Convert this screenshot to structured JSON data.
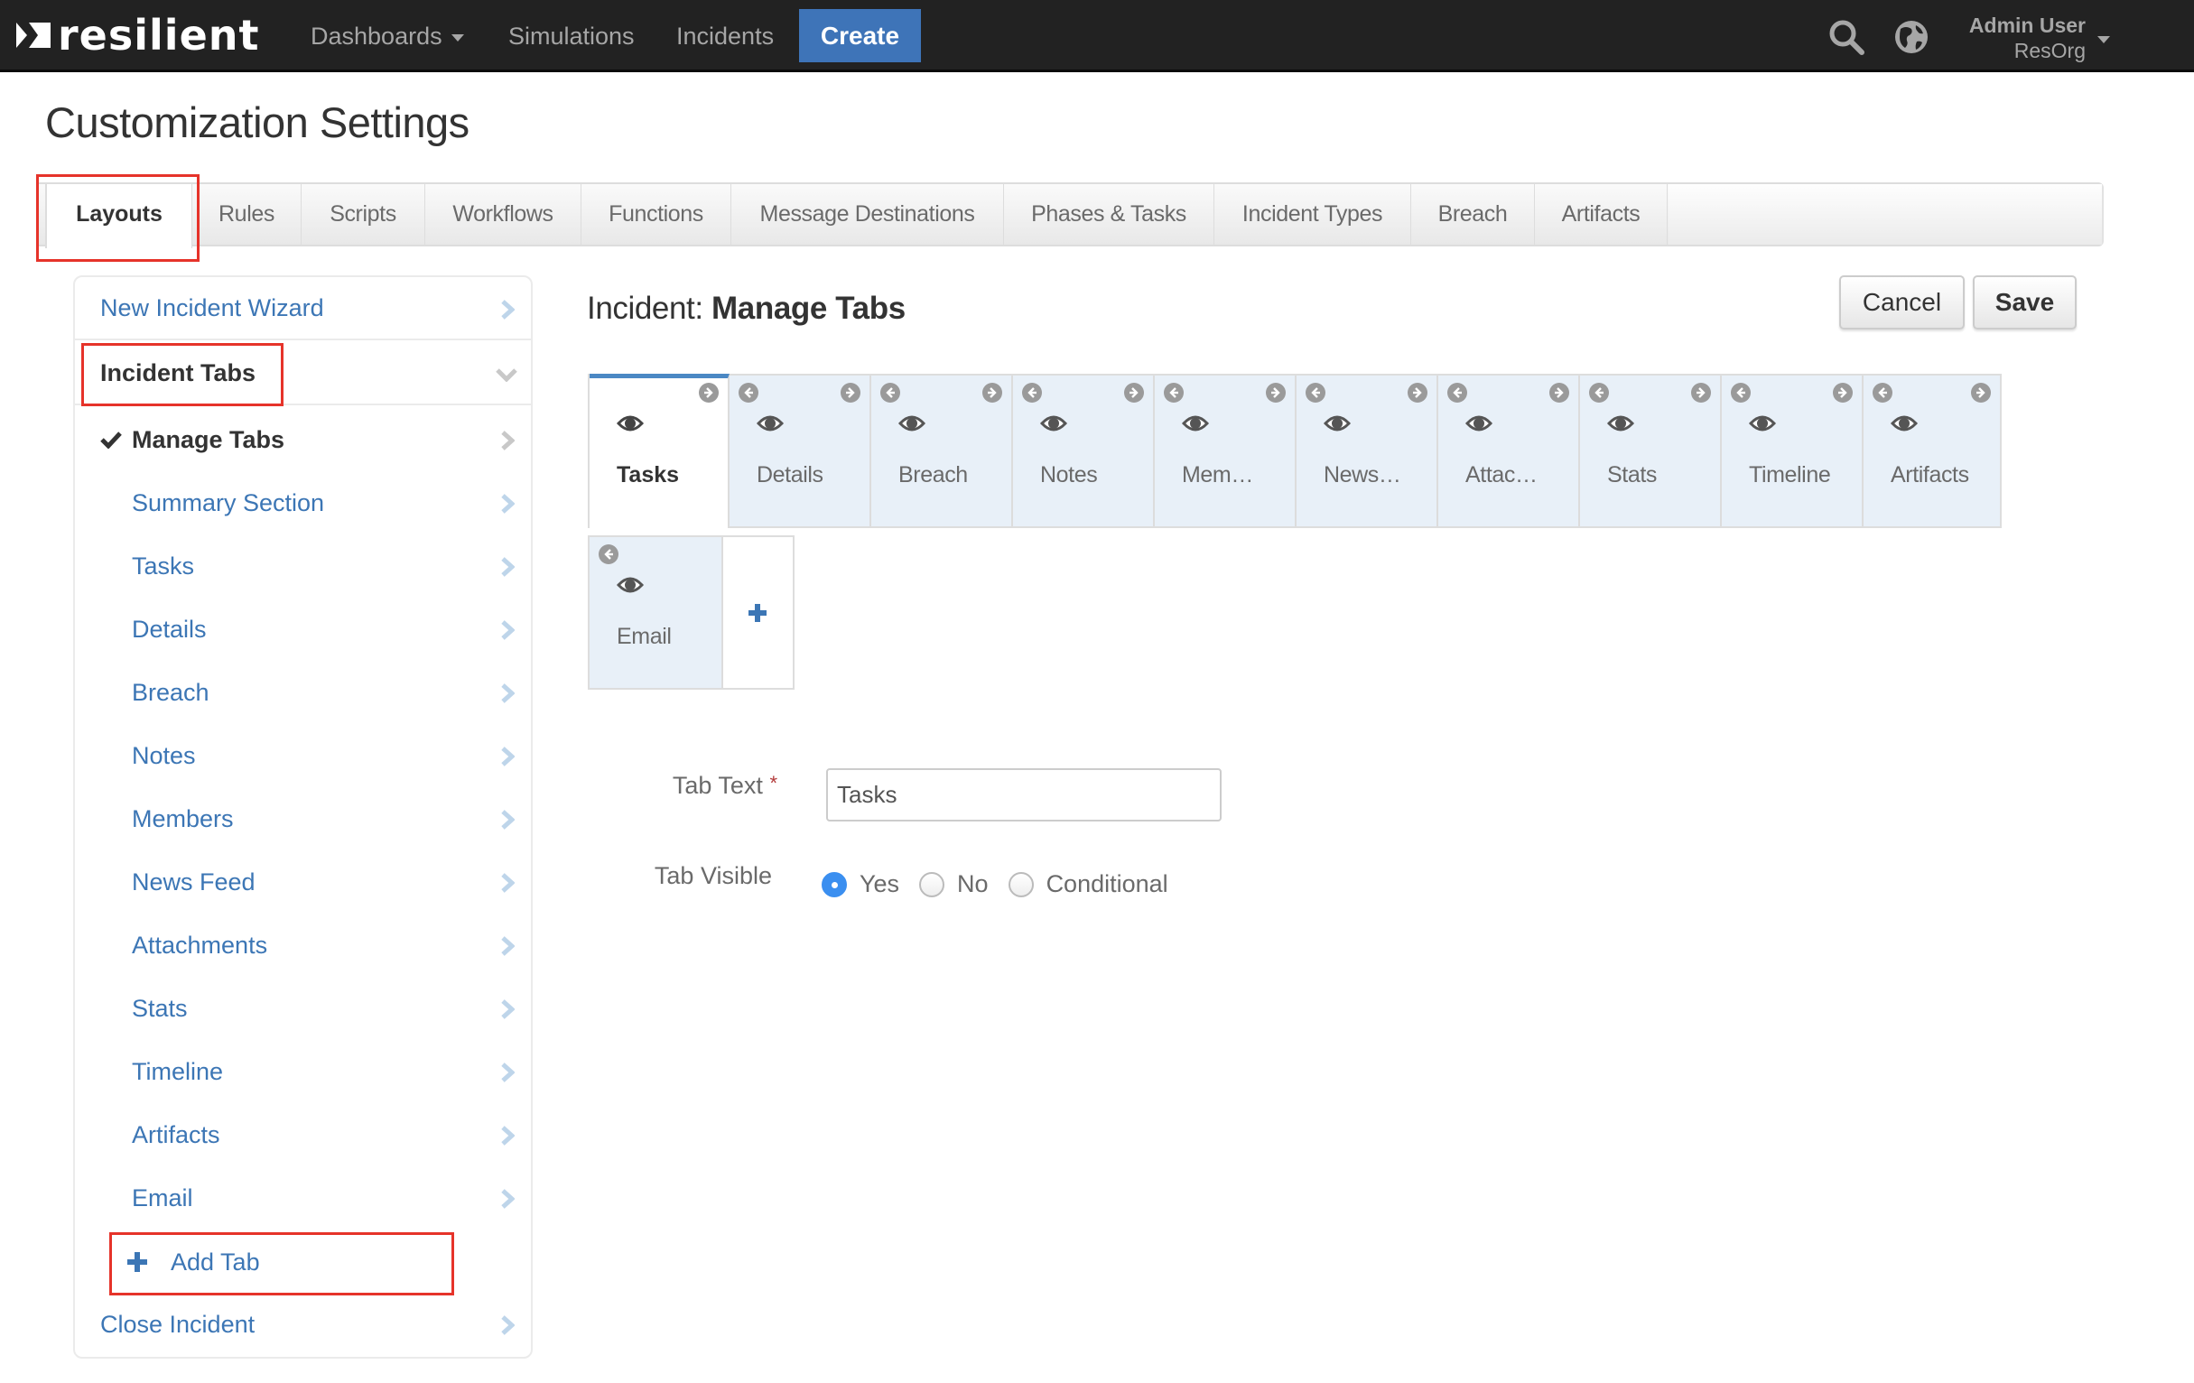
{
  "nav": {
    "brand": "resilient",
    "links": [
      {
        "label": "Dashboards",
        "has_caret": true
      },
      {
        "label": "Simulations"
      },
      {
        "label": "Incidents"
      }
    ],
    "create_label": "Create",
    "icons": [
      "search-icon",
      "globe-icon"
    ],
    "user": {
      "name": "Admin User",
      "org": "ResOrg"
    }
  },
  "page_title": "Customization Settings",
  "settings_tabs": [
    {
      "label": "Layouts",
      "active": true
    },
    {
      "label": "Rules"
    },
    {
      "label": "Scripts"
    },
    {
      "label": "Workflows"
    },
    {
      "label": "Functions"
    },
    {
      "label": "Message Destinations"
    },
    {
      "label": "Phases & Tasks"
    },
    {
      "label": "Incident Types"
    },
    {
      "label": "Breach"
    },
    {
      "label": "Artifacts"
    }
  ],
  "sidebar": {
    "new_incident_wizard": "New Incident Wizard",
    "incident_tabs": "Incident Tabs",
    "manage_tabs": "Manage Tabs",
    "items": [
      "Summary Section",
      "Tasks",
      "Details",
      "Breach",
      "Notes",
      "Members",
      "News Feed",
      "Attachments",
      "Stats",
      "Timeline",
      "Artifacts",
      "Email"
    ],
    "add_tab": "Add Tab",
    "close_incident": "Close Incident"
  },
  "main": {
    "heading_prefix": "Incident:",
    "heading_bold": "Manage Tabs",
    "cancel_label": "Cancel",
    "save_label": "Save",
    "tiles": [
      {
        "label": "Tasks",
        "active": true,
        "visible": true
      },
      {
        "label": "Details",
        "visible": true
      },
      {
        "label": "Breach",
        "visible": true
      },
      {
        "label": "Notes",
        "visible": true
      },
      {
        "label": "Mem…",
        "visible": true
      },
      {
        "label": "News…",
        "visible": true
      },
      {
        "label": "Attac…",
        "visible": true
      },
      {
        "label": "Stats",
        "visible": true
      },
      {
        "label": "Timeline",
        "visible": true
      },
      {
        "label": "Artifacts",
        "visible": true
      },
      {
        "label": "Email",
        "visible": true
      }
    ],
    "form": {
      "tab_text_label": "Tab Text",
      "required_mark": "*",
      "tab_text_value": "Tasks",
      "tab_visible_label": "Tab Visible",
      "visibility_options": [
        "Yes",
        "No",
        "Conditional"
      ],
      "visibility_selected": "Yes"
    }
  },
  "colors": {
    "nav_bg": "#222222",
    "create_button": "#3e74b8",
    "link_blue": "#3c76b5",
    "active_tile_bar": "#4b88c4",
    "tile_bg": "#e8f0f8",
    "radio_selected": "#3b8ff0",
    "highlight_box": "#e6332a"
  }
}
